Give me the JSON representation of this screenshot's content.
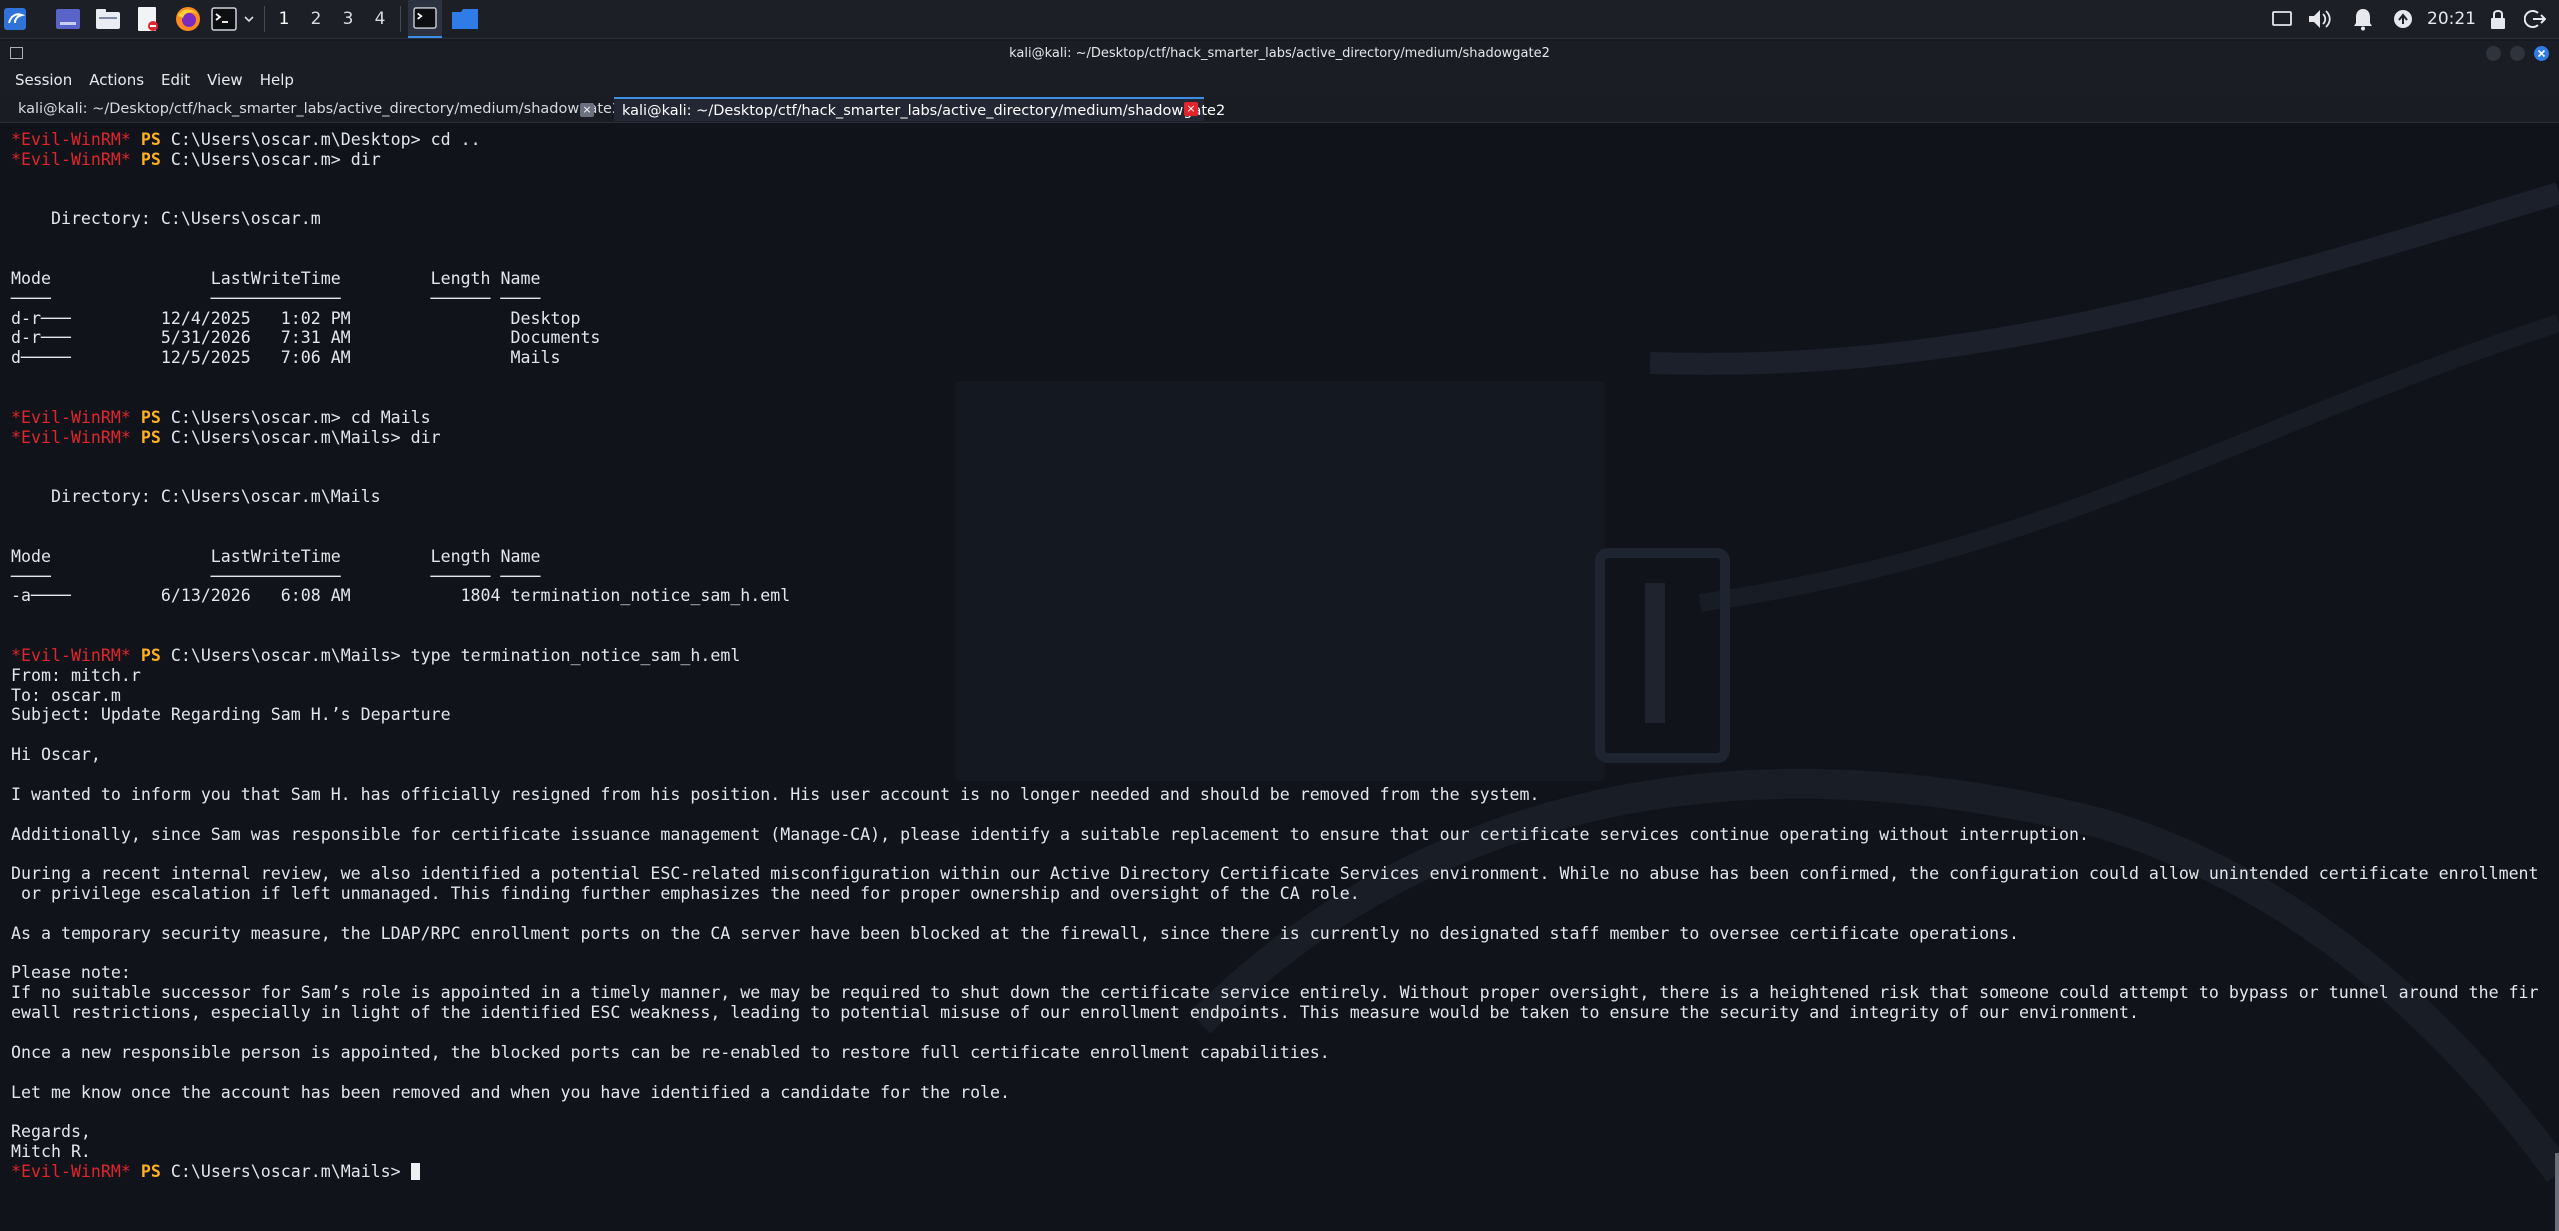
{
  "panel": {
    "workspaces": [
      "1",
      "2",
      "3",
      "4"
    ],
    "clock": "20:21",
    "launcher_icons": [
      "kali-menu-icon",
      "desktop-icon",
      "file-manager-icon",
      "text-editor-icon",
      "firefox-icon",
      "terminal-icon",
      "chevron-down-icon"
    ],
    "task_icons": [
      "terminal-task-icon",
      "folder-task-icon"
    ],
    "tray_icons": [
      "display-icon",
      "volume-icon",
      "bell-icon",
      "update-icon",
      "lock-icon",
      "logout-icon"
    ]
  },
  "window": {
    "title": "kali@kali: ~/Desktop/ctf/hack_smarter_labs/active_directory/medium/shadowgate2"
  },
  "menu": [
    "Session",
    "Actions",
    "Edit",
    "View",
    "Help"
  ],
  "tabs": [
    {
      "label": "kali@kali: ~/Desktop/ctf/hack_smarter_labs/active_directory/medium/shadowgate2",
      "active": false
    },
    {
      "label": "kali@kali: ~/Desktop/ctf/hack_smarter_labs/active_directory/medium/shadowgate2",
      "active": true
    }
  ],
  "prompt": {
    "evil": "*Evil-WinRM*",
    "ps": "PS"
  },
  "terminal_lines": [
    {
      "t": "prompt",
      "path": "C:\\Users\\oscar.m\\Desktop>",
      "cmd": "cd .."
    },
    {
      "t": "prompt",
      "path": "C:\\Users\\oscar.m>",
      "cmd": "dir"
    },
    {
      "t": "text",
      "v": ""
    },
    {
      "t": "text",
      "v": ""
    },
    {
      "t": "text",
      "v": "    Directory: C:\\Users\\oscar.m"
    },
    {
      "t": "text",
      "v": ""
    },
    {
      "t": "text",
      "v": ""
    },
    {
      "t": "text",
      "v": "Mode                LastWriteTime         Length Name"
    },
    {
      "t": "text",
      "v": "────                ─────────────         ────── ────"
    },
    {
      "t": "text",
      "v": "d-r───         12/4/2025   1:02 PM                Desktop"
    },
    {
      "t": "text",
      "v": "d-r───         5/31/2026   7:31 AM                Documents"
    },
    {
      "t": "text",
      "v": "d─────         12/5/2025   7:06 AM                Mails"
    },
    {
      "t": "text",
      "v": ""
    },
    {
      "t": "text",
      "v": ""
    },
    {
      "t": "prompt",
      "path": "C:\\Users\\oscar.m>",
      "cmd": "cd Mails"
    },
    {
      "t": "prompt",
      "path": "C:\\Users\\oscar.m\\Mails>",
      "cmd": "dir"
    },
    {
      "t": "text",
      "v": ""
    },
    {
      "t": "text",
      "v": ""
    },
    {
      "t": "text",
      "v": "    Directory: C:\\Users\\oscar.m\\Mails"
    },
    {
      "t": "text",
      "v": ""
    },
    {
      "t": "text",
      "v": ""
    },
    {
      "t": "text",
      "v": "Mode                LastWriteTime         Length Name"
    },
    {
      "t": "text",
      "v": "────                ─────────────         ────── ────"
    },
    {
      "t": "text",
      "v": "-a────         6/13/2026   6:08 AM           1804 termination_notice_sam_h.eml"
    },
    {
      "t": "text",
      "v": ""
    },
    {
      "t": "text",
      "v": ""
    },
    {
      "t": "prompt",
      "path": "C:\\Users\\oscar.m\\Mails>",
      "cmd": "type termination_notice_sam_h.eml"
    },
    {
      "t": "text",
      "v": "From: mitch.r"
    },
    {
      "t": "text",
      "v": "To: oscar.m"
    },
    {
      "t": "text",
      "v": "Subject: Update Regarding Sam H.’s Departure"
    },
    {
      "t": "text",
      "v": ""
    },
    {
      "t": "text",
      "v": "Hi Oscar,"
    },
    {
      "t": "text",
      "v": ""
    },
    {
      "t": "text",
      "v": "I wanted to inform you that Sam H. has officially resigned from his position. His user account is no longer needed and should be removed from the system."
    },
    {
      "t": "text",
      "v": ""
    },
    {
      "t": "text",
      "v": "Additionally, since Sam was responsible for certificate issuance management (Manage-CA), please identify a suitable replacement to ensure that our certificate services continue operating without interruption."
    },
    {
      "t": "text",
      "v": ""
    },
    {
      "t": "text",
      "v": "During a recent internal review, we also identified a potential ESC-related misconfiguration within our Active Directory Certificate Services environment. While no abuse has been confirmed, the configuration could allow unintended certificate enrollment"
    },
    {
      "t": "text",
      "v": " or privilege escalation if left unmanaged. This finding further emphasizes the need for proper ownership and oversight of the CA role."
    },
    {
      "t": "text",
      "v": ""
    },
    {
      "t": "text",
      "v": "As a temporary security measure, the LDAP/RPC enrollment ports on the CA server have been blocked at the firewall, since there is currently no designated staff member to oversee certificate operations."
    },
    {
      "t": "text",
      "v": ""
    },
    {
      "t": "text",
      "v": "Please note:"
    },
    {
      "t": "text",
      "v": "If no suitable successor for Sam’s role is appointed in a timely manner, we may be required to shut down the certificate service entirely. Without proper oversight, there is a heightened risk that someone could attempt to bypass or tunnel around the fir"
    },
    {
      "t": "text",
      "v": "ewall restrictions, especially in light of the identified ESC weakness, leading to potential misuse of our enrollment endpoints. This measure would be taken to ensure the security and integrity of our environment."
    },
    {
      "t": "text",
      "v": ""
    },
    {
      "t": "text",
      "v": "Once a new responsible person is appointed, the blocked ports can be re-enabled to restore full certificate enrollment capabilities."
    },
    {
      "t": "text",
      "v": ""
    },
    {
      "t": "text",
      "v": "Let me know once the account has been removed and when you have identified a candidate for the role."
    },
    {
      "t": "text",
      "v": ""
    },
    {
      "t": "text",
      "v": "Regards,"
    },
    {
      "t": "text",
      "v": "Mitch R."
    },
    {
      "t": "prompt",
      "path": "C:\\Users\\oscar.m\\Mails>",
      "cmd": "",
      "cursor": true
    }
  ],
  "colors": {
    "evil_prompt": "#e0262c",
    "ps_prompt": "#ffb020",
    "terminal_bg": "#10131a",
    "text": "#e4e6eb",
    "accent": "#3d8ee5"
  }
}
